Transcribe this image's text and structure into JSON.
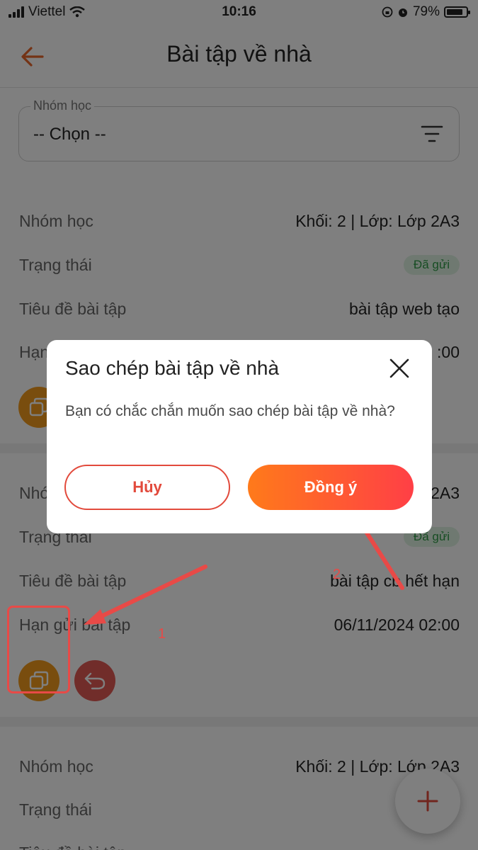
{
  "status_bar": {
    "carrier": "Viettel",
    "time": "10:16",
    "battery": "79%"
  },
  "header": {
    "title": "Bài tập về nhà"
  },
  "filter": {
    "label": "Nhóm học",
    "value": "-- Chọn --"
  },
  "cards": [
    {
      "group_label": "Nhóm học",
      "group_value": "Khối: 2 | Lớp: Lớp 2A3",
      "status_label": "Trạng thái",
      "status_value": "Đã gửi",
      "title_label": "Tiêu đề bài tập",
      "title_value": "bài tập web tạo",
      "deadline_label": "Hạn",
      "deadline_value": ":00"
    },
    {
      "group_label": "Nhó",
      "group_value": "2A3",
      "status_label": "Trạng thái",
      "status_value": "Đã gửi",
      "title_label": "Tiêu đề bài tập",
      "title_value": "bài tập cb hết hạn",
      "deadline_label": "Hạn gửi bài tập",
      "deadline_value": "06/11/2024 02:00"
    },
    {
      "group_label": "Nhóm học",
      "group_value": "Khối: 2 | Lớp: Lớp 2A3",
      "status_label": "Trạng thái",
      "title_label": "Tiêu đề bài tập"
    }
  ],
  "dialog": {
    "title": "Sao chép bài tập về nhà",
    "message": "Bạn có chắc chắn muốn sao chép bài tập về nhà?",
    "cancel_label": "Hủy",
    "confirm_label": "Đồng ý"
  },
  "annotations": {
    "step1": "1",
    "step2": "2"
  },
  "colors": {
    "primary": "#f5781f",
    "danger": "#e24a3c",
    "badge_bg": "#dff3e2",
    "badge_text": "#2f9a46",
    "annotation": "#e84a47"
  }
}
